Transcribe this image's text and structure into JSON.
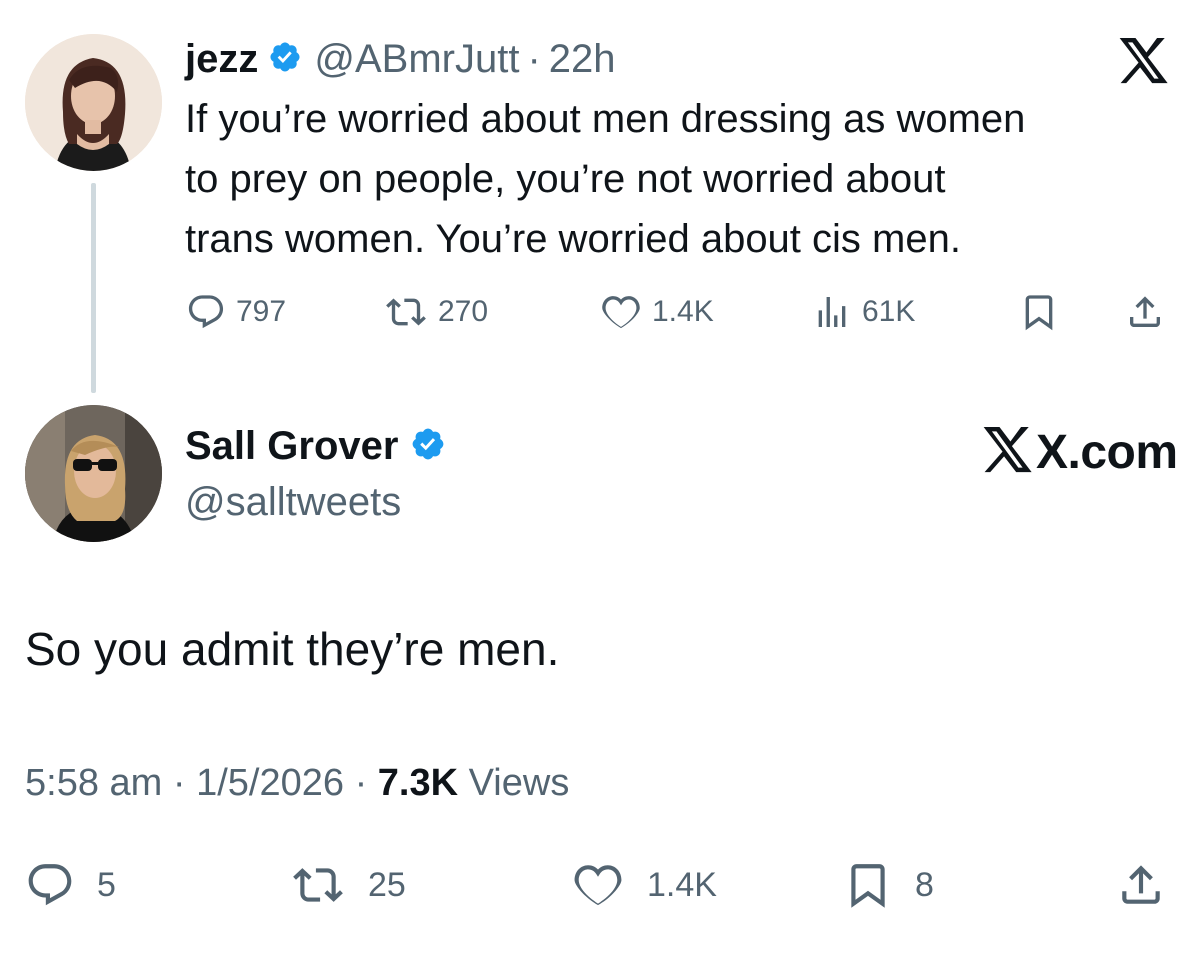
{
  "quoted_tweet": {
    "author_name": "jezz",
    "handle": "@ABmrJutt",
    "separator": "·",
    "time_ago": "22h",
    "text_line1": "If you’re worried about men dressing as women",
    "text_line2": "to prey on people, you’re not worried about",
    "text_line3": "trans women. You’re worried about cis men.",
    "replies": "797",
    "reposts": "270",
    "likes": "1.4K",
    "views": "61K",
    "verified": true
  },
  "main_tweet": {
    "author_name": "Sall Grover",
    "handle": "@salltweets",
    "text": "So you admit they’re men.",
    "time": "5:58 am",
    "separator1": "·",
    "date": "1/5/2026",
    "separator2": "·",
    "views_count": "7.3K",
    "views_label": "Views",
    "replies": "5",
    "reposts": "25",
    "likes": "1.4K",
    "bookmarks": "8",
    "verified": true
  },
  "branding": {
    "site_label": "X.com",
    "logo_icon": "x-logo-icon"
  },
  "colors": {
    "text": "#0f1419",
    "secondary": "#536471",
    "verified": "#1d9bf0",
    "thread_line": "#cfd9de"
  }
}
